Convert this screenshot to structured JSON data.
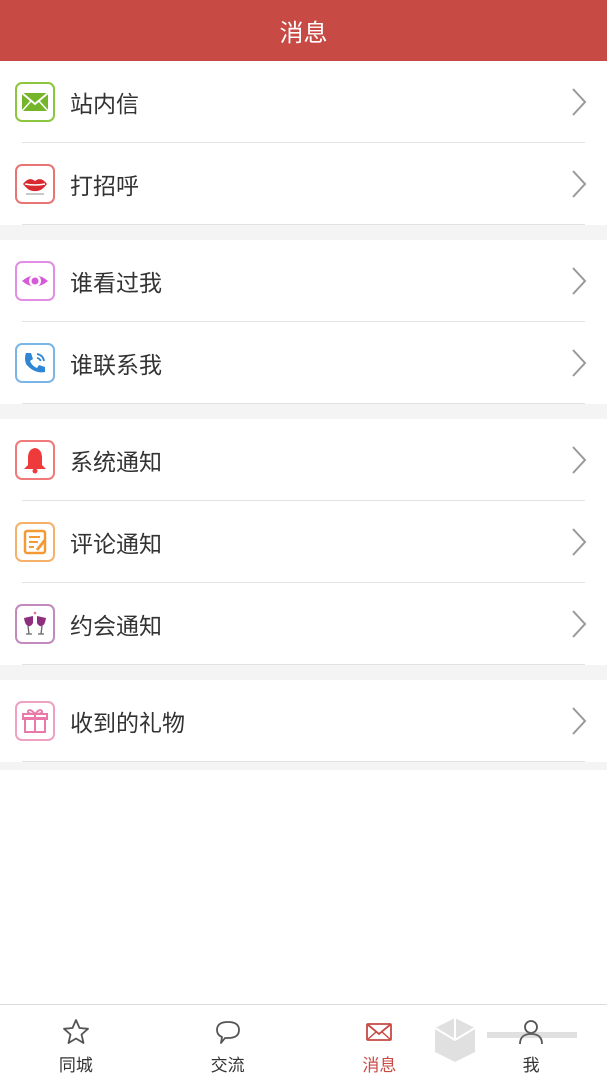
{
  "header": {
    "title": "消息"
  },
  "menu": {
    "groups": [
      {
        "items": [
          {
            "label": "站内信",
            "icon": "mail-icon",
            "color": "#8cc63e"
          },
          {
            "label": "打招呼",
            "icon": "lips-icon",
            "color": "#e35b5b"
          }
        ]
      },
      {
        "items": [
          {
            "label": "谁看过我",
            "icon": "eye-icon",
            "color": "#d65ad8"
          },
          {
            "label": "谁联系我",
            "icon": "phone-icon",
            "color": "#3b8fd8"
          }
        ]
      },
      {
        "items": [
          {
            "label": "系统通知",
            "icon": "bell-icon",
            "color": "#ee3a3a"
          },
          {
            "label": "评论通知",
            "icon": "notepad-icon",
            "color": "#f39a35"
          },
          {
            "label": "约会通知",
            "icon": "wine-glasses-icon",
            "color": "#a24a9c"
          }
        ]
      },
      {
        "items": [
          {
            "label": "收到的礼物",
            "icon": "gift-icon",
            "color": "#e879a8"
          }
        ]
      }
    ]
  },
  "tabbar": {
    "tabs": [
      {
        "label": "同城",
        "icon": "star-icon",
        "active": false
      },
      {
        "label": "交流",
        "icon": "chat-bubble-icon",
        "active": false
      },
      {
        "label": "消息",
        "icon": "envelope-icon",
        "active": true
      },
      {
        "label": "我",
        "icon": "user-icon",
        "active": false
      }
    ],
    "active_color": "#c74a45"
  },
  "colors": {
    "header_bg": "#c74a45",
    "separator": "#e2e2e2",
    "gap_bg": "#f4f4f4"
  }
}
